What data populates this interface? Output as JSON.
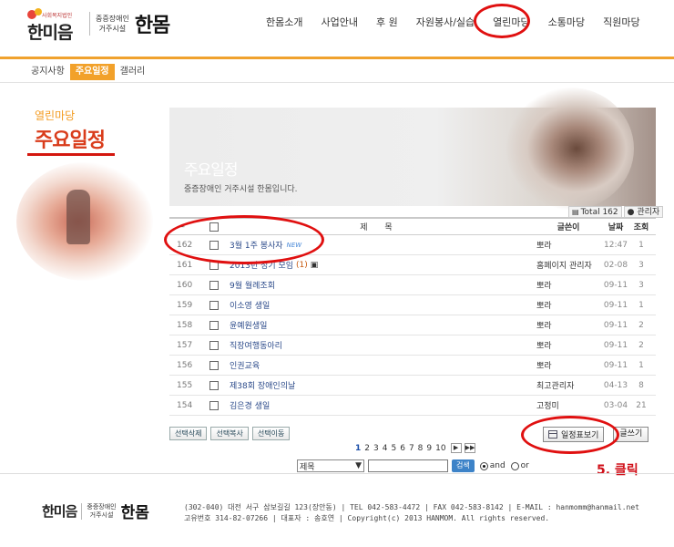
{
  "header": {
    "logo_small": "사회복지법인",
    "logo_text": "한미음",
    "logo_sub1": "중증장애인",
    "logo_sub2": "거주시설",
    "logo_name": "한몸",
    "nav": [
      "한몸소개",
      "사업안내",
      "후 원",
      "자원봉사/실습",
      "열린마당",
      "소통마당",
      "직원마당"
    ],
    "active_nav": "열린마당"
  },
  "subnav": [
    "공지사항",
    "주요일정",
    "갤러리"
  ],
  "side": {
    "subtitle": "열린마당",
    "title": "주요일정"
  },
  "banner": {
    "title": "주요일정",
    "desc": "중증장애인 거주시설 한몸입니다."
  },
  "board": {
    "total": "Total 162",
    "admin": "관리자",
    "headers": {
      "num": "",
      "subject": "제 목",
      "writer": "글쓴이",
      "date": "날짜",
      "hits": "조회"
    },
    "rows": [
      {
        "num": "162",
        "subject": "3월 1주 봉사자",
        "new": "NEW",
        "writer": "뽀라",
        "date": "12:47",
        "hits": "1"
      },
      {
        "num": "161",
        "subject": "2013년 정기 모임",
        "comments": "(1)",
        "file": true,
        "writer": "홈페이지 관리자",
        "date": "02-08",
        "hits": "3"
      },
      {
        "num": "160",
        "subject": "9월 월례조회",
        "writer": "뽀라",
        "date": "09-11",
        "hits": "3"
      },
      {
        "num": "159",
        "subject": "이소영 생일",
        "writer": "뽀라",
        "date": "09-11",
        "hits": "1"
      },
      {
        "num": "158",
        "subject": "윤예원생일",
        "writer": "뽀라",
        "date": "09-11",
        "hits": "2"
      },
      {
        "num": "157",
        "subject": "직장여행동아리",
        "writer": "뽀라",
        "date": "09-11",
        "hits": "2"
      },
      {
        "num": "156",
        "subject": "인권교육",
        "writer": "뽀라",
        "date": "09-11",
        "hits": "1"
      },
      {
        "num": "155",
        "subject": "제38회 장애인의날",
        "writer": "최고관리자",
        "date": "04-13",
        "hits": "8"
      },
      {
        "num": "154",
        "subject": "김은경 생일",
        "writer": "고정미",
        "date": "03-04",
        "hits": "21"
      }
    ]
  },
  "buttons": {
    "select_delete": "선택삭제",
    "select_copy": "선택복사",
    "select_move": "선택이동",
    "schedule_view": "일정표보기",
    "write": "글쓰기"
  },
  "paging": {
    "pages": [
      "1",
      "2",
      "3",
      "4",
      "5",
      "6",
      "7",
      "8",
      "9",
      "10"
    ],
    "current": "1",
    "next": "▶",
    "last": "▶▶"
  },
  "search": {
    "field": "제목",
    "and_label": "and",
    "or_label": "or",
    "button": "검색"
  },
  "annotation": {
    "text": "5. 클릭",
    "color": "#e01010"
  },
  "footer": {
    "line1": "(302-040) 대전 서구 삼보길길 123(장안동) | TEL 042-583-4472 | FAX 042-583-8142 | E-MAIL : hanmomm@hanmail.net",
    "line2": "고유번호 314-82-07266 | 대표자 : 송호연 | Copyright(c) 2013 HANMOM. All rights reserved."
  },
  "colors": {
    "accent": "#f0a22e",
    "title_red": "#d93c1b",
    "link_blue": "#2b4a8a"
  }
}
